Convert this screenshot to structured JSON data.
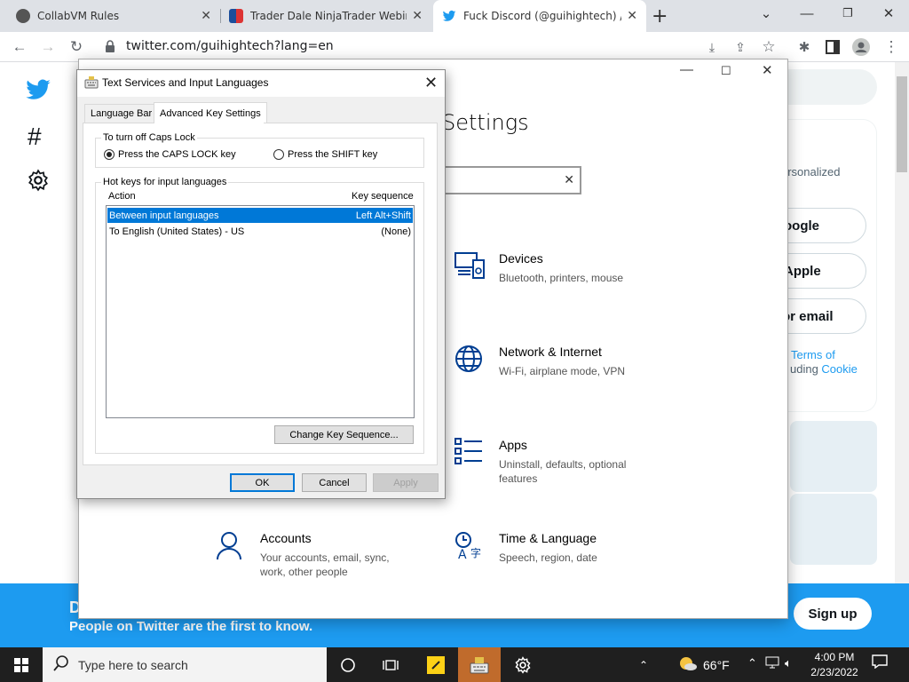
{
  "browser": {
    "tabs": [
      {
        "title": "CollabVM Rules",
        "favicon": "collabvm-icon"
      },
      {
        "title": "Trader Dale NinjaTrader Webinar",
        "favicon": "trader-icon"
      },
      {
        "title": "Fuck Discord (@guihightech) / Tw",
        "favicon": "twitter-bird-icon"
      }
    ],
    "url": "twitter.com/guihightech?lang=en",
    "new_tab": "+"
  },
  "twitter": {
    "right_texts": {
      "personalized": "ersonalized",
      "google": "oogle",
      "apple": "Apple",
      "email": "or email",
      "terms": "Terms of",
      "cookie_prefix": "uding ",
      "cookie": "Cookie"
    },
    "banner": {
      "letter": "D",
      "text": "People on Twitter are the first to know.",
      "signup": "Sign up"
    },
    "accent": "#1d9bf0"
  },
  "settings": {
    "title": "Settings",
    "items": [
      {
        "heading": "Devices",
        "desc": "Bluetooth, printers, mouse",
        "icon": "devices-icon"
      },
      {
        "heading": "Network & Internet",
        "desc": "Wi-Fi, airplane mode, VPN",
        "icon": "globe-icon"
      },
      {
        "heading": "Apps",
        "desc": "Uninstall, defaults, optional features",
        "icon": "apps-list-icon"
      },
      {
        "heading": "Accounts",
        "desc": "Your accounts, email, sync, work, other people",
        "icon": "person-icon"
      },
      {
        "heading": "Time & Language",
        "desc": "Speech, region, date",
        "icon": "time-language-icon"
      }
    ]
  },
  "dialog": {
    "title": "Text Services and Input Languages",
    "tabs": [
      "Language Bar",
      "Advanced Key Settings"
    ],
    "caps_group": "To turn off Caps Lock",
    "radio_caps": "Press the CAPS LOCK key",
    "radio_shift": "Press the SHIFT key",
    "hotkeys_group": "Hot keys for input languages",
    "col_action": "Action",
    "col_key": "Key sequence",
    "rows": [
      {
        "action": "Between input languages",
        "key": "Left Alt+Shift"
      },
      {
        "action": "To English (United States) - US",
        "key": "(None)"
      }
    ],
    "change_btn": "Change Key Sequence...",
    "ok": "OK",
    "cancel": "Cancel",
    "apply": "Apply"
  },
  "taskbar": {
    "search_placeholder": "Type here to search",
    "weather": "66°F",
    "time": "4:00 PM",
    "date": "2/23/2022"
  }
}
